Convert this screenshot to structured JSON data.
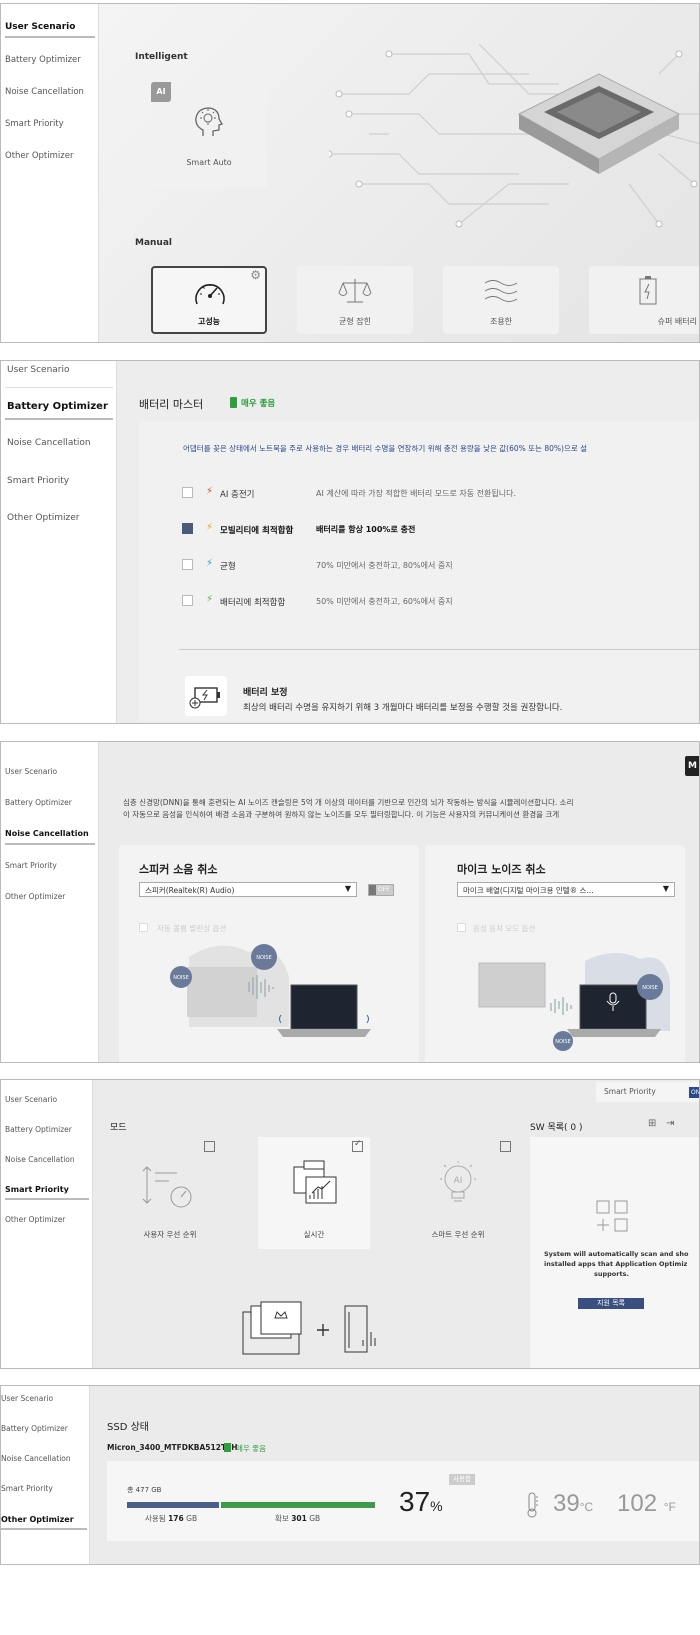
{
  "sidebar_labels": {
    "user_scenario": "User Scenario",
    "battery_optimizer": "Battery Optimizer",
    "noise_cancellation": "Noise Cancellation",
    "smart_priority": "Smart Priority",
    "other_optimizer": "Other Optimizer"
  },
  "panel1": {
    "intelligent_label": "Intelligent",
    "ai_badge": "AI",
    "smart_auto": "Smart Auto",
    "manual_label": "Manual",
    "modes": [
      {
        "label": "고성능",
        "icon": "speedometer-icon",
        "selected": true
      },
      {
        "label": "균형 잡힌",
        "icon": "balance-scale-icon",
        "selected": false
      },
      {
        "label": "조용한",
        "icon": "waves-icon",
        "selected": false
      },
      {
        "label": "슈퍼 배터리",
        "icon": "battery-icon",
        "selected": false
      }
    ]
  },
  "panel2": {
    "title": "배터리 마스터",
    "status": "매우 좋음",
    "status_color": "#2e9e3e",
    "info": "어댑터를 꽂은 상태에서 노트북을 주로 사용하는 경우 배터리 수명을 연장하기 위해 충전 용량을 낮은 값(60% 또는 80%)으로 설",
    "options": [
      {
        "name": "AI 충전기",
        "desc": "AI 계산에 따라 가장 적합한 배터리 모드로 자동 전환됩니다.",
        "checked": false,
        "bolt_color": "#e04a2a"
      },
      {
        "name": "모빌리티에 최적합함",
        "desc": "배터리를 항상 100%로 충전",
        "checked": true,
        "bolt_color": "#f0a020"
      },
      {
        "name": "균형",
        "desc": "70% 미만에서 충전하고, 80%에서 중지",
        "checked": false,
        "bolt_color": "#2a9ee0"
      },
      {
        "name": "배터리에 최적합함",
        "desc": "50% 미만에서 충전하고, 60%에서 중지",
        "checked": false,
        "bolt_color": "#4ac02a"
      }
    ],
    "calibration_title": "배터리 보정",
    "calibration_desc": "최상의 배터리 수명을 유지하기 위해 3 개월마다 배터리를 보정을 수행할 것을 권장합니다."
  },
  "panel3": {
    "top_badge": "M",
    "desc1": "심층 신경망(DNN)을 통해 훈련되는 AI 노이즈 캔슬링은 5억 개 이상의 데이터를 기반으로 인간의 뇌가 작동하는 방식을 시뮬레이션합니다. 소리",
    "desc2": "이 자동으로 음성을 인식하여 배경 소음과 구분하여 원하지 않는 노이즈를 모두 필터링합니다. 이 기능은 사용자의 커뮤니케이션 환경을 크게 ",
    "speaker_title": "스피커 소음 취소",
    "speaker_device": "스피커(Realtek(R) Audio)",
    "toggle": "OFF",
    "speaker_option": "자동 볼륨 밸런싱 옵션",
    "mic_title": "마이크 노이즈 취소",
    "mic_device": "마이크 배열(디지털 마이크용 인텔® 스...",
    "mic_option": "음성 음치 모드 옵션",
    "noise": "NOISE"
  },
  "panel4": {
    "tab_label": "Smart Priority",
    "tab_badge": "ON",
    "mode_label": "모드",
    "modes": [
      {
        "label": "사용자 우선 순위",
        "checked": false
      },
      {
        "label": "실시간",
        "checked": true
      },
      {
        "label": "스마트 우선 순위",
        "checked": false
      }
    ],
    "sw_label": "SW 목록( 0 )",
    "sw_desc": [
      "System will automatically scan and sho",
      "installed apps that Application Optimiz",
      "supports."
    ],
    "sw_button": "지원 목록"
  },
  "panel5": {
    "title": "SSD 상태",
    "drive": "Micron_3400_MTFDKBA512TFH",
    "status": "매우 좋음",
    "total": "총 477 GB",
    "used_label": "사용됨",
    "used_value": "176",
    "free_label": "확보",
    "free_value": "301",
    "unit_gb": "GB",
    "used_fraction": 0.37,
    "used_color": "#4a5f88",
    "free_color": "#3f9a4a",
    "percent_value": "37",
    "percent_sign": "%",
    "used_badge": "사용함",
    "temp_c": "39",
    "unit_c": "°C",
    "temp_f": "102",
    "unit_f": "°F"
  }
}
